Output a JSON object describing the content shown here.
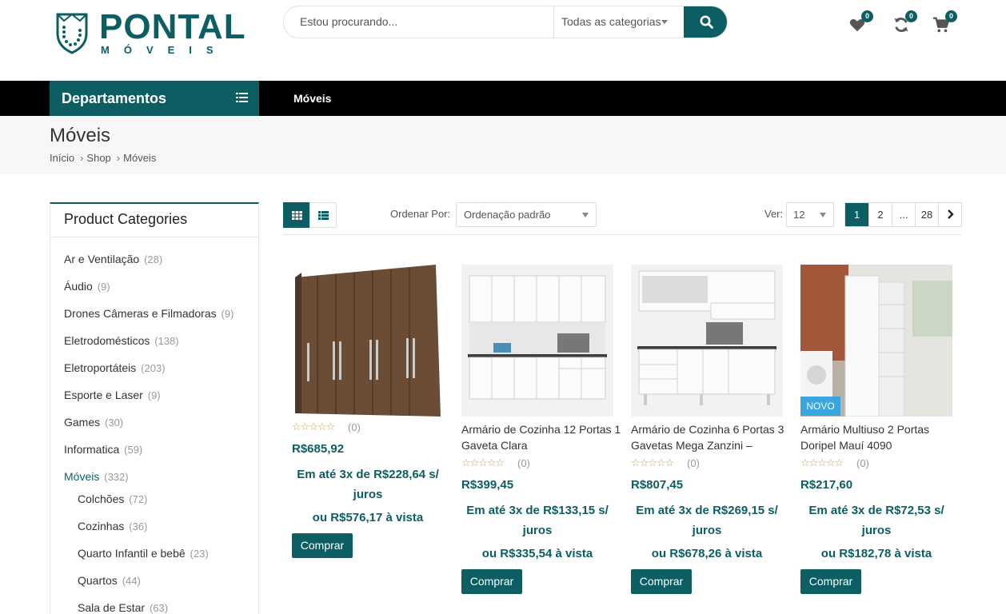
{
  "brand": {
    "name": "PONTAL",
    "sub": "MÓVEIS",
    "color": "#0c5e63"
  },
  "search": {
    "placeholder": "Estou procurando...",
    "category": "Todas as categorias"
  },
  "header_icons": [
    {
      "name": "heart-icon",
      "badge": "0"
    },
    {
      "name": "refresh-icon",
      "badge": "0"
    },
    {
      "name": "cart-icon",
      "badge": "0"
    }
  ],
  "nav": {
    "departments": "Departamentos",
    "link": "Móveis"
  },
  "page": {
    "title": "Móveis",
    "breadcrumb": [
      "Início",
      "Shop",
      "Móveis"
    ]
  },
  "sidebar": {
    "title": "Product Categories",
    "categories": [
      {
        "label": "Ar e Ventilação",
        "count": "(28)"
      },
      {
        "label": "Áudio",
        "count": "(9)"
      },
      {
        "label": "Drones Câmeras e Filmadoras",
        "count": "(9)"
      },
      {
        "label": "Eletrodomésticos",
        "count": "(138)"
      },
      {
        "label": "Eletroportáteis",
        "count": "(203)"
      },
      {
        "label": "Esporte e Laser",
        "count": "(9)"
      },
      {
        "label": "Games",
        "count": "(30)"
      },
      {
        "label": "Informatica",
        "count": "(59)"
      },
      {
        "label": "Móveis",
        "count": "(332)"
      },
      {
        "label": "Colchões",
        "count": "(72)"
      },
      {
        "label": "Cozinhas",
        "count": "(36)"
      },
      {
        "label": "Quarto Infantil e bebê",
        "count": "(23)"
      },
      {
        "label": "Quartos",
        "count": "(44)"
      },
      {
        "label": "Sala de Estar",
        "count": "(63)"
      }
    ]
  },
  "toolbar": {
    "order_label": "Ordenar Por:",
    "order_value": "Ordenação padrão",
    "ver_label": "Ver:",
    "ver_value": "12",
    "pages": [
      "1",
      "2",
      "...",
      "28"
    ]
  },
  "products": [
    {
      "name": "",
      "reviews": "(0)",
      "price": "R$685,92",
      "installment": "Em até 3x de R$228,64 s/ juros",
      "cash": "ou R$576,17 à vista",
      "buy": "Comprar",
      "badge": ""
    },
    {
      "name": "Armário de Cozinha 12 Portas 1 Gaveta Clara",
      "reviews": "(0)",
      "price": "R$399,45",
      "installment": "Em até 3x de R$133,15 s/ juros",
      "cash": "ou R$335,54 à vista",
      "buy": "Comprar",
      "badge": ""
    },
    {
      "name": "Armário de Cozinha 6 Portas 3 Gavetas Mega Zanzini –",
      "reviews": "(0)",
      "price": "R$807,45",
      "installment": "Em até 3x de R$269,15 s/ juros",
      "cash": "ou R$678,26 à vista",
      "buy": "Comprar",
      "badge": ""
    },
    {
      "name": "Armário Multiuso 2 Portas Doripel Mauí 4090",
      "reviews": "(0)",
      "price": "R$217,60",
      "installment": "Em até 3x de R$72,53 s/ juros",
      "cash": "ou R$182,78 à vista",
      "buy": "Comprar",
      "badge": "NOVO"
    }
  ]
}
